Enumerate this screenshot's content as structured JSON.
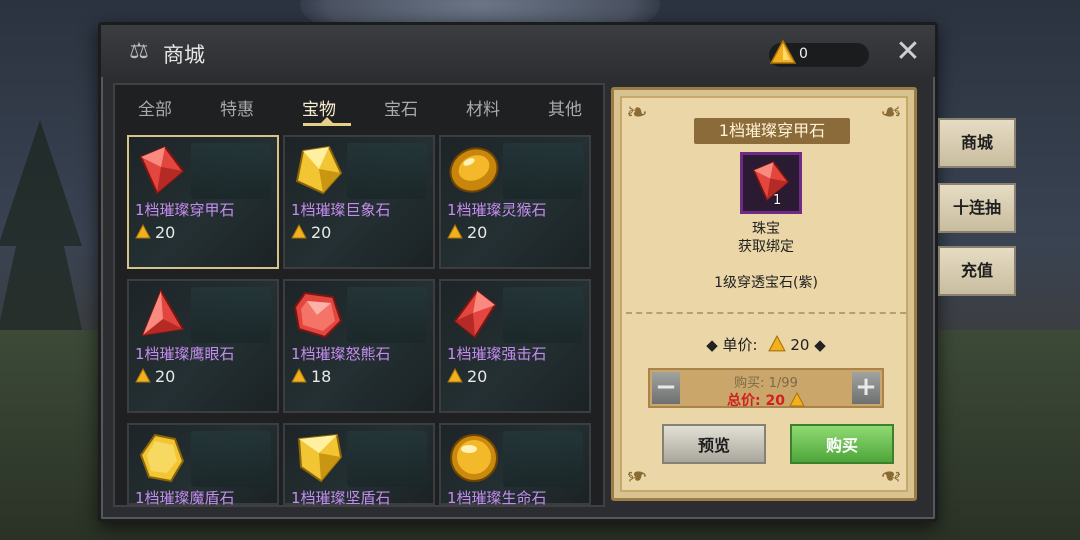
{
  "window": {
    "title": "商城",
    "currency_value": "0"
  },
  "tabs": [
    "全部",
    "特惠",
    "宝物",
    "宝石",
    "材料",
    "其他"
  ],
  "items": [
    {
      "name": "1档璀璨穿甲石",
      "price": "20",
      "icon": "red-diamond-gem"
    },
    {
      "name": "1档璀璨巨象石",
      "price": "20",
      "icon": "yellow-crystal-gem"
    },
    {
      "name": "1档璀璨灵猴石",
      "price": "20",
      "icon": "amber-oval-gem"
    },
    {
      "name": "1档璀璨鹰眼石",
      "price": "20",
      "icon": "red-triangle-gem"
    },
    {
      "name": "1档璀璨怒熊石",
      "price": "18",
      "icon": "red-hex-gem"
    },
    {
      "name": "1档璀璨强击石",
      "price": "20",
      "icon": "red-diamond-gem"
    },
    {
      "name": "1档璀璨魔盾石",
      "price": "",
      "icon": "yellow-oval-gem"
    },
    {
      "name": "1档璀璨坚盾石",
      "price": "",
      "icon": "yellow-shield-gem"
    },
    {
      "name": "1档璀璨生命石",
      "price": "",
      "icon": "gold-orb-gem"
    }
  ],
  "detail": {
    "title": "1档璀璨穿甲石",
    "count": "1",
    "category": "珠宝",
    "binding": "获取绑定",
    "description": "1级穿透宝石(紫)",
    "unit_price_label": "单价:",
    "unit_price": "20",
    "buy_count": "购买: 1/99",
    "total_label": "总价: 20",
    "preview_label": "预览",
    "buy_label": "购买"
  },
  "side_tabs": [
    "商城",
    "十连抽",
    "充值"
  ],
  "colors": {
    "item_name": "#c58cf0",
    "accent": "#e6cf87",
    "total_price": "#d21f1f"
  }
}
